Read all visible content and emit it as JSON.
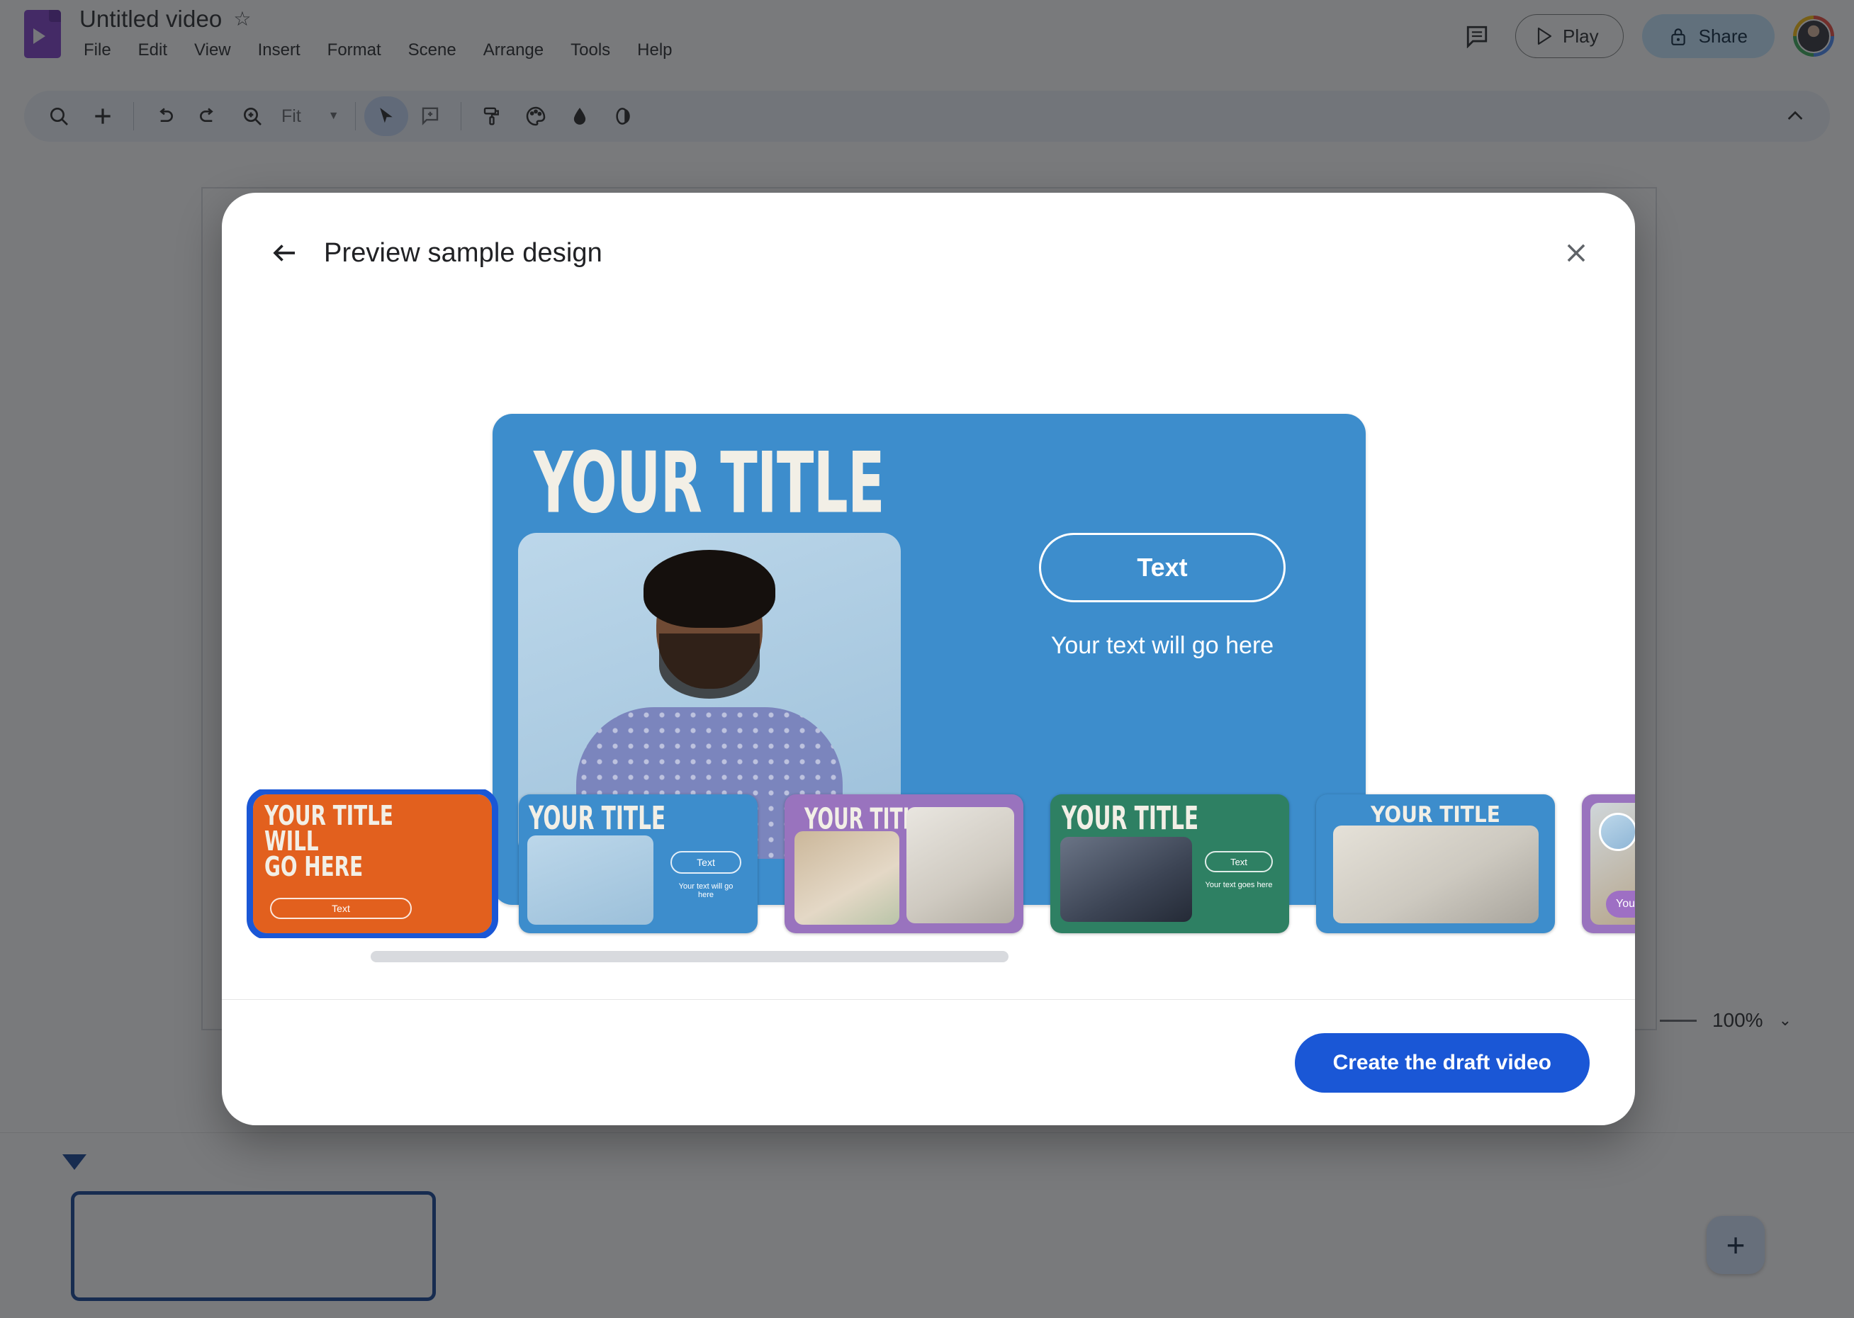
{
  "app": {
    "doc_title": "Untitled video",
    "star_icon": "star-outline-icon",
    "logo_icon": "google-vids-logo",
    "menus": [
      "File",
      "Edit",
      "View",
      "Insert",
      "Format",
      "Scene",
      "Arrange",
      "Tools",
      "Help"
    ],
    "header_actions": {
      "comment_icon": "comment-icon",
      "play_label": "Play",
      "play_icon": "play-triangle-icon",
      "share_label": "Share",
      "share_icon": "lock-icon",
      "avatar": "user-avatar"
    },
    "toolbar": {
      "zoom_select_value": "Fit",
      "icons": [
        "search-icon",
        "add-icon",
        "undo-icon",
        "redo-icon",
        "zoom-in-icon",
        "select-cursor-icon",
        "add-comment-icon",
        "paint-roller-icon",
        "palette-icon",
        "color-drop-icon",
        "transparency-icon",
        "collapse-chevron-icon"
      ]
    },
    "zoom_control": {
      "value": "100%",
      "chevron_icon": "chevron-down-icon"
    },
    "timeline": {
      "playhead_icon": "playhead-marker-icon",
      "add_scene_icon": "plus-icon"
    }
  },
  "modal": {
    "back_icon": "arrow-back-icon",
    "title": "Preview sample design",
    "close_icon": "close-icon",
    "footer": {
      "primary_label": "Create the draft video"
    },
    "preview": {
      "bg_color": "#3D8DCC",
      "title": "YOUR TITLE",
      "pill_label": "Text",
      "subtext": "Your text will go here",
      "photo_alt": "smiling-man-in-patterned-shirt"
    },
    "thumbnails": [
      {
        "id": "thumb-orange-title",
        "selected": true,
        "bg_color": "#E2601E",
        "title": "YOUR TITLE WILL\nGO HERE",
        "pill_label": "Text"
      },
      {
        "id": "thumb-blue-portrait",
        "selected": false,
        "bg_color": "#3D8DCC",
        "title": "YOUR TITLE",
        "pill_label": "Text",
        "subtext": "Your text will go here"
      },
      {
        "id": "thumb-purple-duo",
        "selected": false,
        "bg_color": "#9973BE",
        "title": "YOUR TITLE"
      },
      {
        "id": "thumb-green-portrait",
        "selected": false,
        "bg_color": "#2E8063",
        "title": "YOUR TITLE",
        "pill_label": "Text",
        "subtext": "Your text goes here"
      },
      {
        "id": "thumb-blue-office",
        "selected": false,
        "bg_color": "#3D8DCC",
        "title": "YOUR TITLE"
      },
      {
        "id": "thumb-purple-caption",
        "selected": false,
        "bg_color": "#9973BE",
        "caption": "Your text goes here"
      }
    ]
  }
}
